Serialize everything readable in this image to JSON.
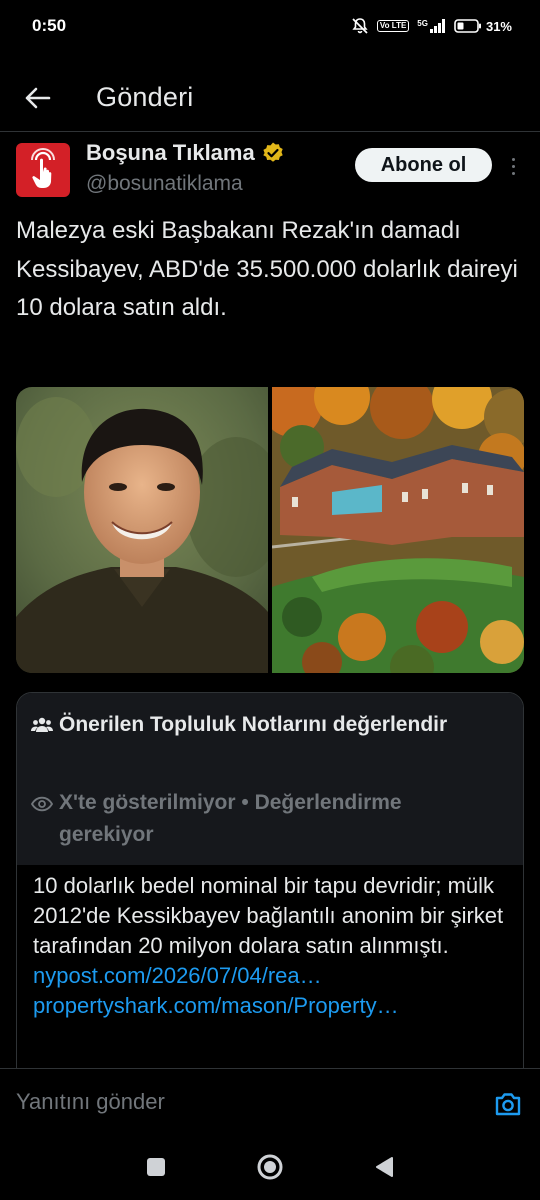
{
  "status_bar": {
    "time": "0:50",
    "network": "5G",
    "volte": "Vo LTE",
    "battery": "31%"
  },
  "header": {
    "title": "Gönderi",
    "back_icon": "arrow-left-icon"
  },
  "post": {
    "author_name": "Boşuna Tıklama",
    "author_handle": "@bosunatiklama",
    "verified_color": "#e2b719",
    "subscribe_label": "Abone ol",
    "text": "Malezya eski Başbakanı Rezak'ın damadı Kessibayev, ABD'de 35.500.000 dolarlık daireyi 10 dolara satın aldı."
  },
  "community_note": {
    "title": "Önerilen Topluluk Notlarını değerlendir",
    "status": "X'te gösterilmiyor • Değerlendirme gerekiyor",
    "body": "10 dolarlık bedel nominal bir tapu devridir; mülk 2012'de Kessikbayev bağlantılı anonim bir şirket tarafından 20 milyon dolara satın alınmıştı.",
    "links": [
      "nypost.com/2026/07/04/rea…",
      "propertyshark.com/mason/Property…"
    ]
  },
  "reply": {
    "placeholder": "Yanıtını gönder"
  },
  "colors": {
    "background": "#000000",
    "text": "#e7e9ea",
    "muted": "#71767b",
    "link": "#1d9bf0",
    "brand_red": "#d32027"
  }
}
